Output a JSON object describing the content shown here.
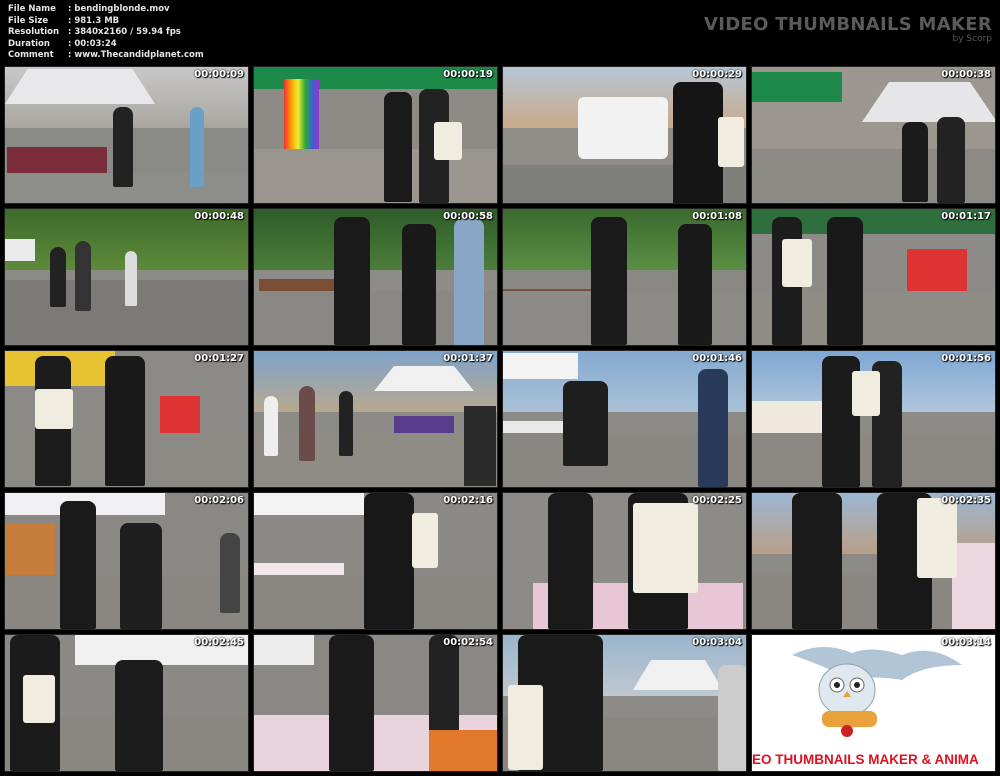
{
  "header": {
    "rows": [
      {
        "key": "File Name",
        "value": ": bendingblonde.mov"
      },
      {
        "key": "File Size",
        "value": ": 981.3 MB"
      },
      {
        "key": "Resolution",
        "value": ": 3840x2160 / 59.94 fps"
      },
      {
        "key": "Duration",
        "value": ": 00:03:24"
      },
      {
        "key": "Comment",
        "value": ": www.Thecandidplanet.com"
      }
    ],
    "brand_title": "VIDEO THUMBNAILS MAKER",
    "brand_sub": "by Scorp"
  },
  "thumbnails": [
    {
      "time": "00:00:09"
    },
    {
      "time": "00:00:19"
    },
    {
      "time": "00:00:29"
    },
    {
      "time": "00:00:38"
    },
    {
      "time": "00:00:48"
    },
    {
      "time": "00:00:58"
    },
    {
      "time": "00:01:08"
    },
    {
      "time": "00:01:17"
    },
    {
      "time": "00:01:27"
    },
    {
      "time": "00:01:37"
    },
    {
      "time": "00:01:46"
    },
    {
      "time": "00:01:56"
    },
    {
      "time": "00:02:06"
    },
    {
      "time": "00:02:16"
    },
    {
      "time": "00:02:25"
    },
    {
      "time": "00:02:35"
    },
    {
      "time": "00:02:45"
    },
    {
      "time": "00:02:54"
    },
    {
      "time": "00:03:04"
    },
    {
      "time": "00:03:14"
    }
  ],
  "logo_text": "EO THUMBNAILS MAKER & ANIMA",
  "colors": {
    "background": "#000000",
    "header_text": "#e6e6e6",
    "brand_text": "#5a5a5a",
    "logo_red": "#dd1122"
  }
}
